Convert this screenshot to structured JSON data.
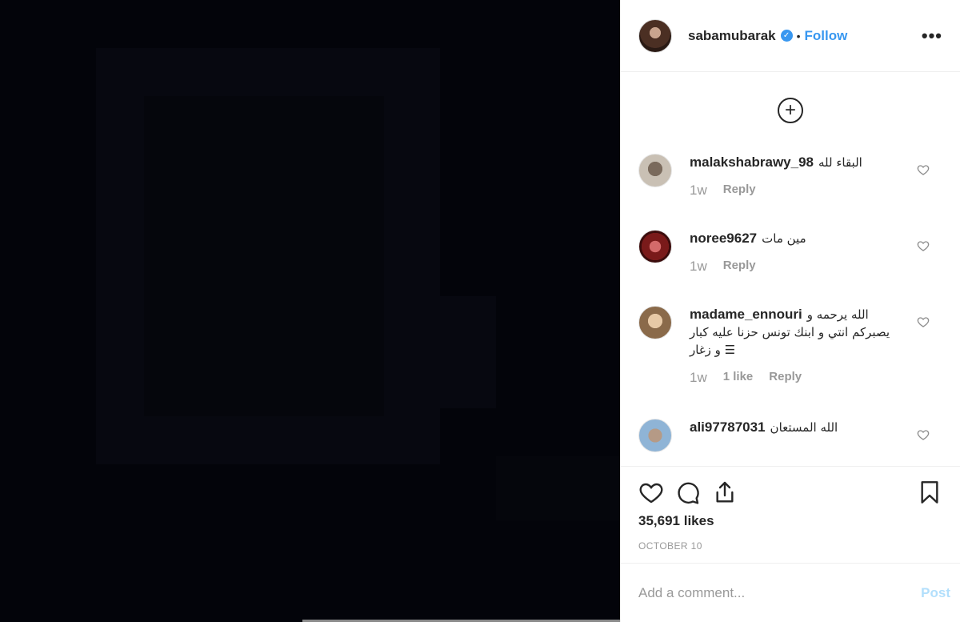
{
  "header": {
    "username": "sabamubarak",
    "separator": "•",
    "follow_label": "Follow",
    "more_label": "•••",
    "verified_glyph": "✓"
  },
  "comments": {
    "load_more_glyph": "+",
    "items": [
      {
        "user": "malakshabrawy_98",
        "text": "البقاء لله",
        "time": "1w",
        "likes": "",
        "reply": "Reply"
      },
      {
        "user": "noree9627",
        "text": "مين مات",
        "time": "1w",
        "likes": "",
        "reply": "Reply"
      },
      {
        "user": "madame_ennouri",
        "text": "الله يرحمه و يصبركم انتي و ابنك تونس حزنا عليه كبار و زغار ☰",
        "time": "1w",
        "likes": "1 like",
        "reply": "Reply"
      },
      {
        "user": "ali97787031",
        "text": "الله المستعان",
        "time": "",
        "likes": "",
        "reply": ""
      }
    ]
  },
  "post": {
    "likes": "35,691 likes",
    "date": "OCTOBER 10"
  },
  "add_comment": {
    "placeholder": "Add a comment...",
    "post_label": "Post"
  },
  "colors": {
    "accent": "#3897f0",
    "post_disabled": "#b2dffc",
    "media_bg": "#03040a"
  },
  "icons": [
    "heart-icon",
    "comment-icon",
    "share-icon",
    "bookmark-icon",
    "verified-badge-icon",
    "plus-circle-icon",
    "more-options-icon"
  ]
}
